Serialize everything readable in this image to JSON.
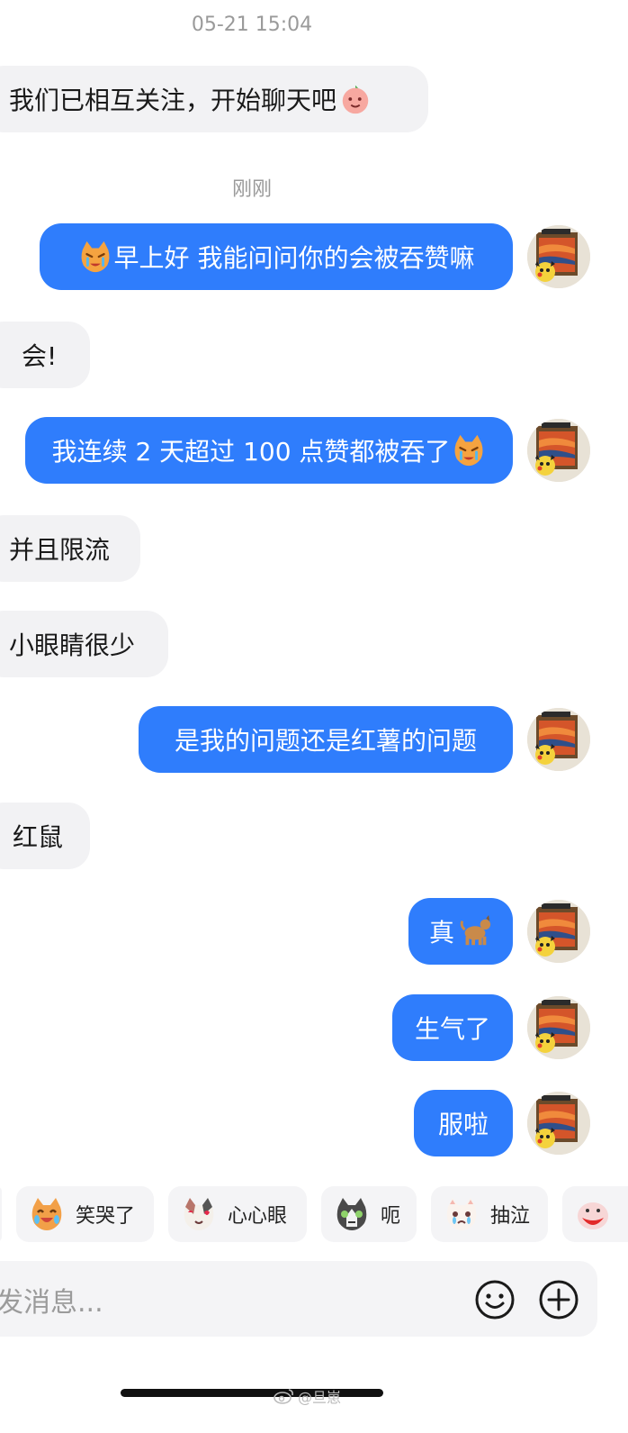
{
  "conversation": {
    "timestamps": [
      "05-21 15:04",
      "刚刚"
    ],
    "messages": [
      {
        "side": "in",
        "text": "我们已相互关注，开始聊天吧",
        "emoji": "peach-sticker-icon"
      },
      {
        "side": "out",
        "text": "早上好 我能问问你的会被吞赞嘛",
        "emoji": "crying-cat-icon"
      },
      {
        "side": "in",
        "text": "会!"
      },
      {
        "side": "out",
        "text": "我连续 2 天超过 100 点赞都被吞了",
        "emoji": "crying-cat-icon"
      },
      {
        "side": "in",
        "text": "并且限流"
      },
      {
        "side": "in",
        "text": "小眼睛很少"
      },
      {
        "side": "out",
        "text": "是我的问题还是红薯的问题"
      },
      {
        "side": "in",
        "text": "红鼠"
      },
      {
        "side": "out",
        "text": "真",
        "emoji": "dog-icon"
      },
      {
        "side": "out",
        "text": "生气了"
      },
      {
        "side": "out",
        "text": "服啦"
      }
    ]
  },
  "sticker_bar": {
    "items": [
      {
        "label": "笑哭了",
        "icon": "laughing-cat-icon"
      },
      {
        "label": "心心眼",
        "icon": "heart-eyes-cat-icon"
      },
      {
        "label": "呃",
        "icon": "grey-cat-icon"
      },
      {
        "label": "抽泣",
        "icon": "sobbing-cat-icon"
      }
    ]
  },
  "composer": {
    "placeholder": "发消息...",
    "emoji_icon": "smiley-icon",
    "add_icon": "plus-circle-icon"
  },
  "watermark": "@旦崽",
  "colors": {
    "outgoing_bubble": "#2f7dfc",
    "incoming_bubble": "#f2f2f4",
    "timestamp": "#9a9a9a"
  }
}
